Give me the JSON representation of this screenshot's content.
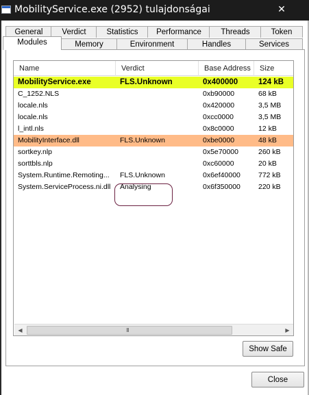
{
  "window": {
    "title": "MobilityService.exe (2952) tulajdonságai",
    "close_glyph": "✕"
  },
  "tabs_row1": [
    "General",
    "Verdict",
    "Statistics",
    "Performance",
    "Threads",
    "Token"
  ],
  "tabs_row2": [
    "Modules",
    "Memory",
    "Environment",
    "Handles",
    "Services"
  ],
  "active_tab": "Modules",
  "columns": [
    "Name",
    "Verdict",
    "Base Address",
    "Size"
  ],
  "modules": [
    {
      "name": "MobilityService.exe",
      "verdict": "FLS.Unknown",
      "base": "0x400000",
      "size": "124 kB",
      "highlight": "green"
    },
    {
      "name": "C_1252.NLS",
      "verdict": "",
      "base": "0xb90000",
      "size": "68 kB",
      "highlight": ""
    },
    {
      "name": "locale.nls",
      "verdict": "",
      "base": "0x420000",
      "size": "3,5 MB",
      "highlight": ""
    },
    {
      "name": "locale.nls",
      "verdict": "",
      "base": "0xcc0000",
      "size": "3,5 MB",
      "highlight": ""
    },
    {
      "name": "l_intl.nls",
      "verdict": "",
      "base": "0x8c0000",
      "size": "12 kB",
      "highlight": ""
    },
    {
      "name": "MobilityInterface.dll",
      "verdict": "FLS.Unknown",
      "base": "0xbe0000",
      "size": "48 kB",
      "highlight": "orange"
    },
    {
      "name": "sortkey.nlp",
      "verdict": "",
      "base": "0x5e70000",
      "size": "260 kB",
      "highlight": ""
    },
    {
      "name": "sorttbls.nlp",
      "verdict": "",
      "base": "0xc60000",
      "size": "20 kB",
      "highlight": ""
    },
    {
      "name": "System.Runtime.Remoting...",
      "verdict": "FLS.Unknown",
      "base": "0x6ef40000",
      "size": "772 kB",
      "highlight": ""
    },
    {
      "name": "System.ServiceProcess.ni.dll",
      "verdict": "Analysing",
      "base": "0x6f350000",
      "size": "220 kB",
      "highlight": ""
    }
  ],
  "colors": {
    "highlight_green": "#e9ff26",
    "highlight_orange": "#ffbb88",
    "annotation": "#6a2040"
  },
  "scrollbar": {
    "left_arrow": "◀",
    "right_arrow": "▶",
    "grip": "III"
  },
  "buttons": {
    "show_safe": "Show Safe",
    "close": "Close"
  }
}
